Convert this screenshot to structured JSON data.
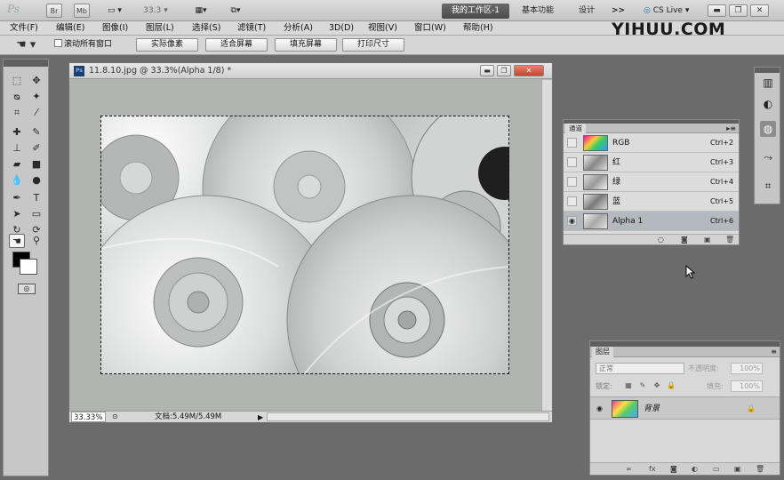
{
  "appbar": {
    "logo": "Ps",
    "br": "Br",
    "mb": "Mb",
    "zoom": "33.3",
    "workspace_active": "我的工作区-1",
    "workspace_items": [
      "基本功能",
      "设计"
    ],
    "more": ">>",
    "cs_live": "CS Live"
  },
  "menubar": {
    "items": [
      "文件(F)",
      "编辑(E)",
      "图像(I)",
      "图层(L)",
      "选择(S)",
      "滤镜(T)",
      "分析(A)",
      "3D(D)",
      "视图(V)",
      "窗口(W)",
      "帮助(H)"
    ]
  },
  "watermark": {
    "text_a": "YIHU",
    "text_b": "U.COM"
  },
  "options": {
    "scroll_all_label": "滚动所有窗口",
    "buttons": [
      "实际像素",
      "适合屏幕",
      "填充屏幕",
      "打印尺寸"
    ]
  },
  "document": {
    "title": "11.8.10.jpg @ 33.3%(Alpha 1/8) *",
    "zoom": "33.33%",
    "info": "文档:5.49M/5.49M"
  },
  "channels": {
    "tab": "通道",
    "rows": [
      {
        "name": "RGB",
        "key": "Ctrl+2"
      },
      {
        "name": "红",
        "key": "Ctrl+3"
      },
      {
        "name": "绿",
        "key": "Ctrl+4"
      },
      {
        "name": "蓝",
        "key": "Ctrl+5"
      },
      {
        "name": "Alpha 1",
        "key": "Ctrl+6"
      }
    ]
  },
  "layers": {
    "tab": "图层",
    "blend": "正常",
    "opacity_label": "不透明度:",
    "opacity": "100%",
    "lock_label": "锁定:",
    "fill_label": "填充:",
    "fill": "100%",
    "layer_name": "背景"
  }
}
